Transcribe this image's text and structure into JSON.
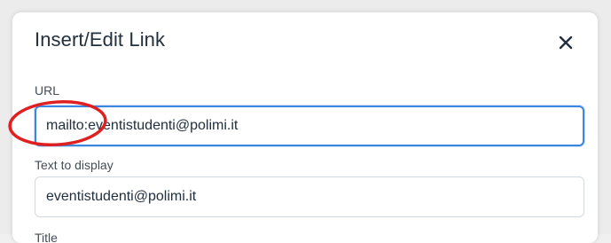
{
  "dialog": {
    "title": "Insert/Edit Link",
    "close_label": "×"
  },
  "fields": {
    "url": {
      "label": "URL",
      "value": "mailto:eventistudenti@polimi.it"
    },
    "text_to_display": {
      "label": "Text to display",
      "value": "eventistudenti@polimi.it"
    },
    "title": {
      "label": "Title"
    }
  },
  "annotation": {
    "color": "#e02020"
  },
  "colors": {
    "focus_border": "#3b86e0",
    "text": "#222f3e"
  }
}
